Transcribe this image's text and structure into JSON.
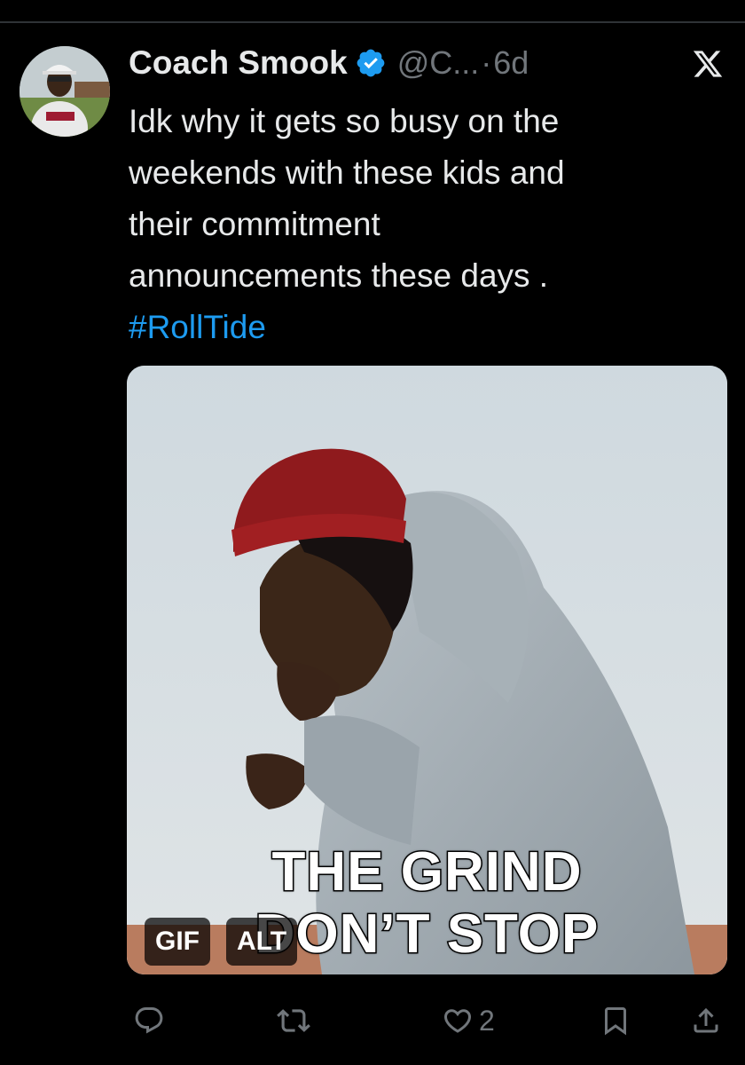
{
  "tweet": {
    "author_name": "Coach Smook",
    "handle": "@C...",
    "separator": "·",
    "time": "6d",
    "text_lines": [
      "Idk why it gets so busy on the",
      "weekends with these kids and",
      "their commitment",
      "announcements these days ."
    ],
    "hashtag": "#RollTide"
  },
  "media": {
    "caption_line1": "THE GRIND",
    "caption_line2": "DON’T STOP",
    "gif_badge": "GIF",
    "alt_badge": "ALT"
  },
  "actions": {
    "like_count": "2"
  },
  "colors": {
    "background": "#000000",
    "text": "#e7e9ea",
    "secondary_text": "#71767b",
    "accent": "#1d9bf0"
  },
  "icons": {
    "verified": "verified-badge-icon",
    "brand": "x-logo-icon",
    "reply": "reply-icon",
    "repost": "repost-icon",
    "like": "heart-icon",
    "bookmark": "bookmark-icon",
    "share": "share-icon"
  }
}
